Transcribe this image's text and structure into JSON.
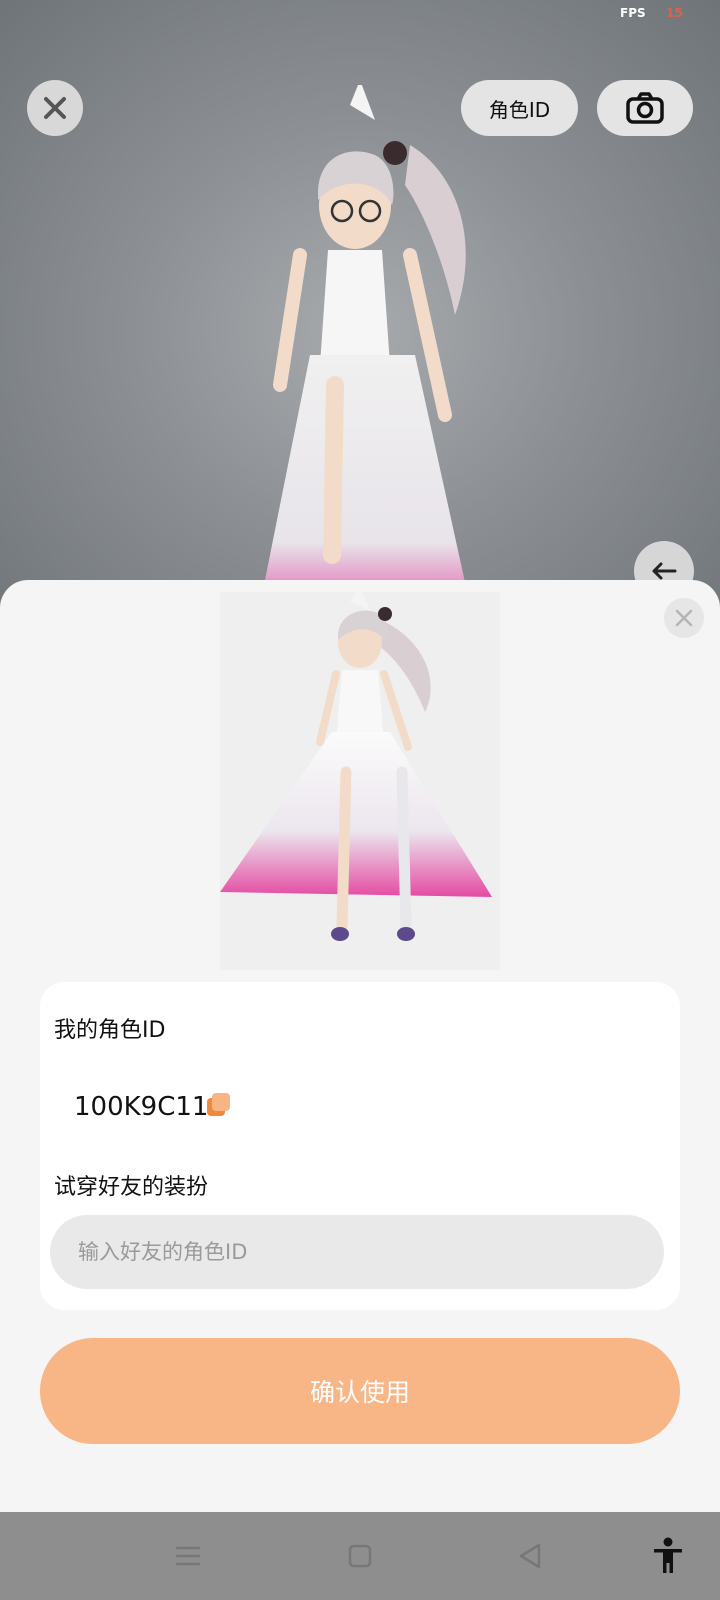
{
  "status": {
    "fps_label": "FPS",
    "fps_value": "15"
  },
  "top_bar": {
    "role_id_label": "角色ID",
    "icons": [
      "close-icon",
      "camera-icon",
      "back-arrow-icon"
    ]
  },
  "dialog": {
    "my_role_id_label": "我的角色ID",
    "my_role_id_value": "100K9C11",
    "try_friend_label": "试穿好友的装扮",
    "friend_input_placeholder": "输入好友的角色ID",
    "friend_input_value": "",
    "confirm_label": "确认使用",
    "icons": [
      "close-icon",
      "copy-icon"
    ]
  },
  "colors": {
    "accent": "#f8b586",
    "copy_icon": "#f08a3c",
    "sheet_bg": "#f5f5f5",
    "card_bg": "#ffffff",
    "input_bg": "#e9e9e9"
  },
  "nav_bar": {
    "icons": [
      "menu-icon",
      "home-icon",
      "back-icon",
      "accessibility-icon"
    ]
  }
}
